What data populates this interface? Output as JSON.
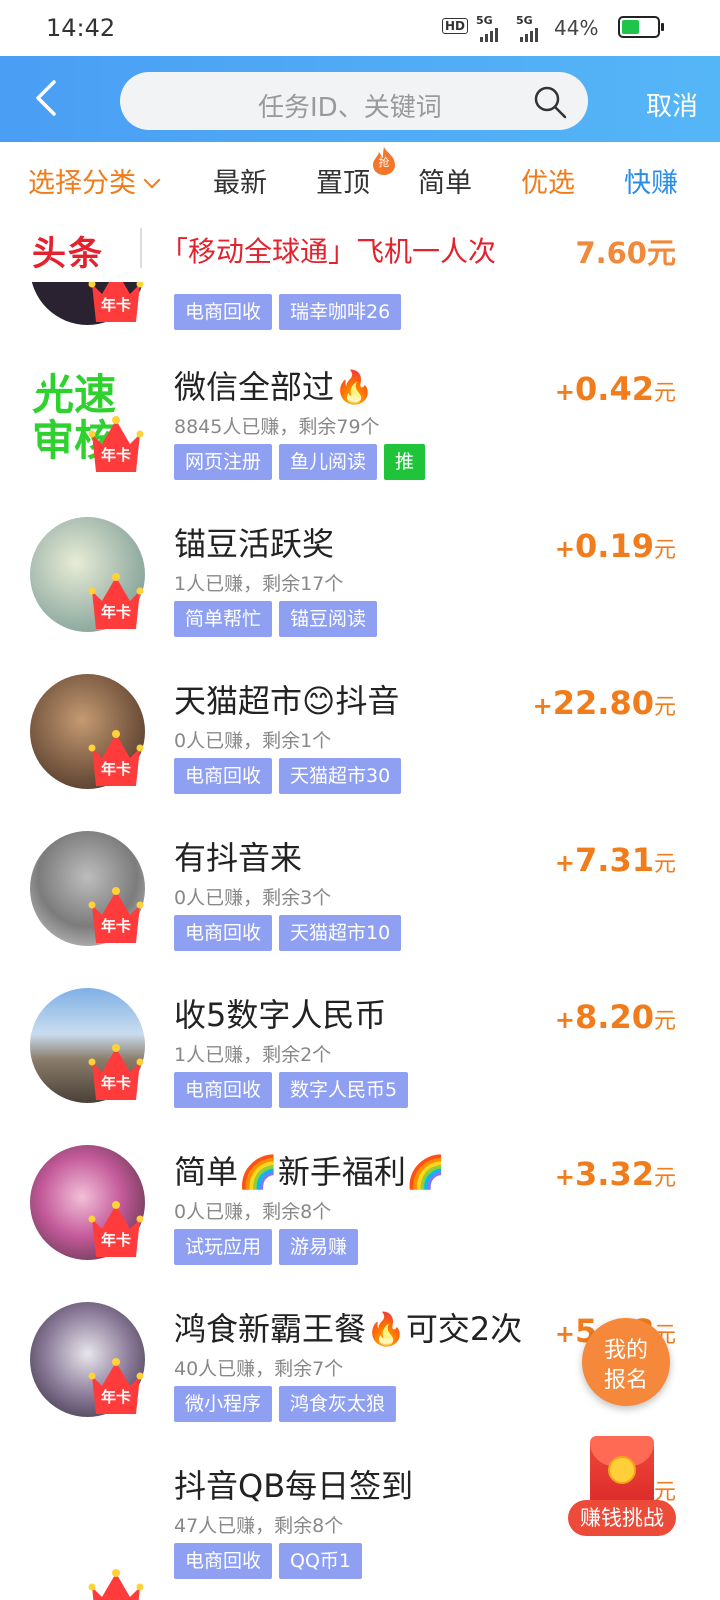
{
  "status": {
    "time": "14:42",
    "hd": "HD",
    "net1": "5G",
    "net2": "5G",
    "battery": "44%",
    "battery_level": 0.44
  },
  "header": {
    "search_placeholder": "任务ID、关键词",
    "cancel": "取消"
  },
  "categories": {
    "select": "选择分类",
    "latest": "最新",
    "top": "置顶",
    "top_badge": "抢",
    "simple": "简单",
    "preferred": "优选",
    "quick": "快赚"
  },
  "headline": {
    "logo": "头条",
    "title": "「移动全球通」飞机一人次",
    "price": "7.60元"
  },
  "crown_label": "年卡",
  "items": [
    {
      "title": "",
      "stats": "",
      "tags": [
        "电商回收",
        "瑞幸咖啡26"
      ],
      "price": ""
    },
    {
      "title": "微信全部过🔥",
      "stats": "8845人已赚，剩余79个",
      "tags": [
        "网页注册",
        "鱼儿阅读",
        "推"
      ],
      "plus": "+",
      "price": "0.42",
      "unit": "元",
      "avatar_text": "光速审核"
    },
    {
      "title": "锚豆活跃奖",
      "stats": "1人已赚，剩余17个",
      "tags": [
        "简单帮忙",
        "锚豆阅读"
      ],
      "plus": "+",
      "price": "0.19",
      "unit": "元"
    },
    {
      "title": "天猫超市😊抖音",
      "stats": "0人已赚，剩余1个",
      "tags": [
        "电商回收",
        "天猫超市30"
      ],
      "plus": "+",
      "price": "22.80",
      "unit": "元"
    },
    {
      "title": "有抖音来",
      "stats": "0人已赚，剩余3个",
      "tags": [
        "电商回收",
        "天猫超市10"
      ],
      "plus": "+",
      "price": "7.31",
      "unit": "元"
    },
    {
      "title": "收5数字人民币",
      "stats": "1人已赚，剩余2个",
      "tags": [
        "电商回收",
        "数字人民币5"
      ],
      "plus": "+",
      "price": "8.20",
      "unit": "元"
    },
    {
      "title": "简单🌈新手福利🌈",
      "stats": "0人已赚，剩余8个",
      "tags": [
        "试玩应用",
        "游易赚"
      ],
      "plus": "+",
      "price": "3.32",
      "unit": "元"
    },
    {
      "title": "鸿食新霸王餐🔥可交2次",
      "stats": "40人已赚，剩余7个",
      "tags": [
        "微小程序",
        "鸿食灰太狼"
      ],
      "plus": "+",
      "price": "5.08",
      "unit": "元"
    },
    {
      "title": "抖音QB每日签到",
      "stats": "47人已赚，剩余8个",
      "tags": [
        "电商回收",
        "QQ币1"
      ],
      "plus": "+",
      "price": "",
      "unit": "元"
    }
  ],
  "float": {
    "signup_line1": "我的",
    "signup_line2": "报名",
    "challenge": "赚钱挑战"
  }
}
